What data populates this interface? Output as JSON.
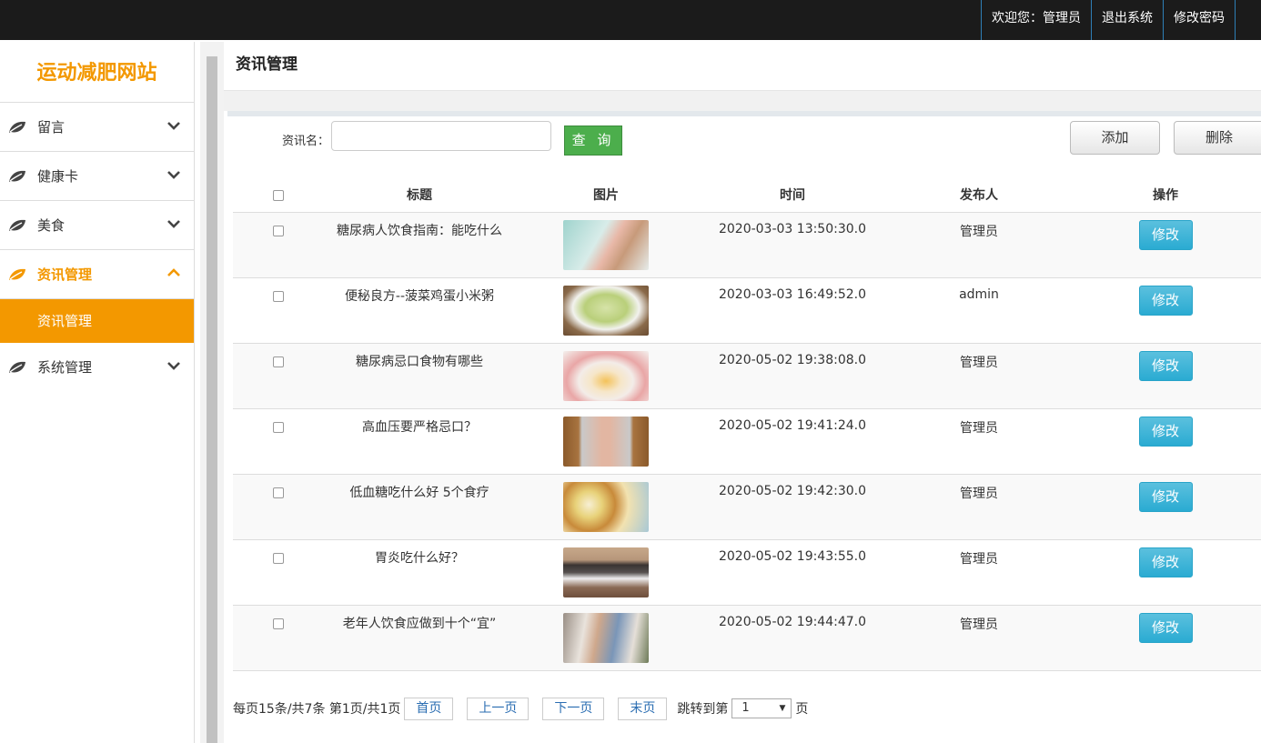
{
  "topbar": {
    "welcome": "欢迎您：管理员",
    "logout": "退出系统",
    "change_password": "修改密码"
  },
  "sidebar": {
    "brand": "运动减肥网站",
    "items": [
      {
        "label": "留言",
        "icon": "leaf-icon",
        "expanded": false
      },
      {
        "label": "健康卡",
        "icon": "leaf-icon",
        "expanded": false
      },
      {
        "label": "美食",
        "icon": "leaf-icon",
        "expanded": false
      },
      {
        "label": "资讯管理",
        "icon": "leaf-icon",
        "expanded": true
      },
      {
        "label": "系统管理",
        "icon": "leaf-icon",
        "expanded": false
      }
    ],
    "submenu": {
      "label": "资讯管理"
    },
    "accent": "#f39800"
  },
  "main": {
    "title": "资讯管理",
    "search": {
      "label": "资讯名：",
      "value": "",
      "button": "查 询"
    },
    "add_button": "添加",
    "delete_button": "删除",
    "table": {
      "headers": [
        "标题",
        "图片",
        "时间",
        "发布人",
        "操作"
      ],
      "rows": [
        {
          "title": "糖尿病人饮食指南：能吃什么",
          "time": "2020-03-03 13:50:30.0",
          "publisher": "管理员",
          "action": "修改"
        },
        {
          "title": "便秘良方--菠菜鸡蛋小米粥",
          "time": "2020-03-03 16:49:52.0",
          "publisher": "admin",
          "action": "修改"
        },
        {
          "title": "糖尿病忌口食物有哪些",
          "time": "2020-05-02 19:38:08.0",
          "publisher": "管理员",
          "action": "修改"
        },
        {
          "title": "高血压要严格忌口？",
          "time": "2020-05-02 19:41:24.0",
          "publisher": "管理员",
          "action": "修改"
        },
        {
          "title": "低血糖吃什么好 5个食疗",
          "time": "2020-05-02 19:42:30.0",
          "publisher": "管理员",
          "action": "修改"
        },
        {
          "title": "胃炎吃什么好？",
          "time": "2020-05-02 19:43:55.0",
          "publisher": "管理员",
          "action": "修改"
        },
        {
          "title": "老年人饮食应做到十个“宜”",
          "time": "2020-05-02 19:44:47.0",
          "publisher": "管理员",
          "action": "修改"
        }
      ]
    },
    "pager": {
      "summary": "每页15条/共7条 第1页/共1页",
      "first": "首页",
      "prev": "上一页",
      "next": "下一页",
      "last": "末页",
      "jump_label": "跳转到第",
      "page_value": "1",
      "page_suffix": "页"
    }
  }
}
